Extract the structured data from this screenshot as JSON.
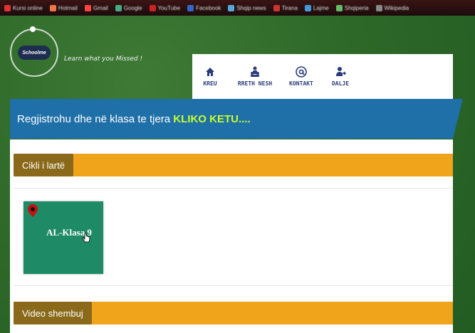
{
  "browser": {
    "bookmarks": [
      {
        "label": "Kursi online",
        "color": "#d33"
      },
      {
        "label": "Hotmail",
        "color": "#e74"
      },
      {
        "label": "Gmail",
        "color": "#f44"
      },
      {
        "label": "Google",
        "color": "#4a8"
      },
      {
        "label": "YouTube",
        "color": "#c22"
      },
      {
        "label": "Facebook",
        "color": "#36c"
      },
      {
        "label": "Shqip news",
        "color": "#5ad"
      },
      {
        "label": "Tirana",
        "color": "#c33"
      },
      {
        "label": "Lajme",
        "color": "#49d"
      },
      {
        "label": "Shqiperia",
        "color": "#6b6"
      },
      {
        "label": "Wikipedia",
        "color": "#888"
      }
    ]
  },
  "header": {
    "logo_text": "Schoolme",
    "tagline": "Learn what you Missed !"
  },
  "nav": {
    "items": [
      {
        "label": "KREU",
        "icon": "home-icon"
      },
      {
        "label": "RRETH NESH",
        "icon": "people-icon"
      },
      {
        "label": "KONTAKT",
        "icon": "at-sign-icon"
      },
      {
        "label": "DALJE",
        "icon": "logout-icon"
      }
    ]
  },
  "banner": {
    "text": "Regjistrohu dhe në klasa te tjera ",
    "link": "KLIKO KETU...."
  },
  "sections": {
    "cycle": "Cikli i lartë",
    "class_card": "AL-Klasa 9",
    "video": "Video shembuj"
  },
  "colors": {
    "accent_orange": "#f0a41c",
    "banner_blue": "#1f6fa8",
    "link_green": "#c6ff2e",
    "card_green": "#1e8a66"
  }
}
